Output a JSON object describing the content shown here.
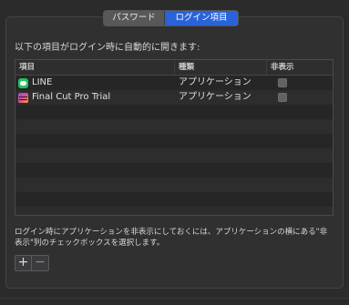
{
  "tabs": {
    "password": "パスワード",
    "login_items": "ログイン項目",
    "selected": "login_items"
  },
  "instructions": "以下の項目がログイン時に自動的に開きます:",
  "table": {
    "headers": {
      "item": "項目",
      "kind": "種類",
      "hide": "非表示"
    },
    "rows": [
      {
        "icon": "line-app-icon",
        "name": "LINE",
        "kind": "アプリケーション",
        "hidden": false
      },
      {
        "icon": "final-cut-pro-icon",
        "name": "Final Cut Pro Trial",
        "kind": "アプリケーション",
        "hidden": false
      }
    ]
  },
  "footer_note": "ログイン時にアプリケーションを非表示にしておくには、アプリケーションの横にある\"非表示\"列のチェックボックスを選択します。",
  "buttons": {
    "add": "+",
    "remove": "−"
  },
  "colors": {
    "accent": "#2a63d9",
    "background": "#2b2b2c",
    "line_green": "#22c35d"
  }
}
